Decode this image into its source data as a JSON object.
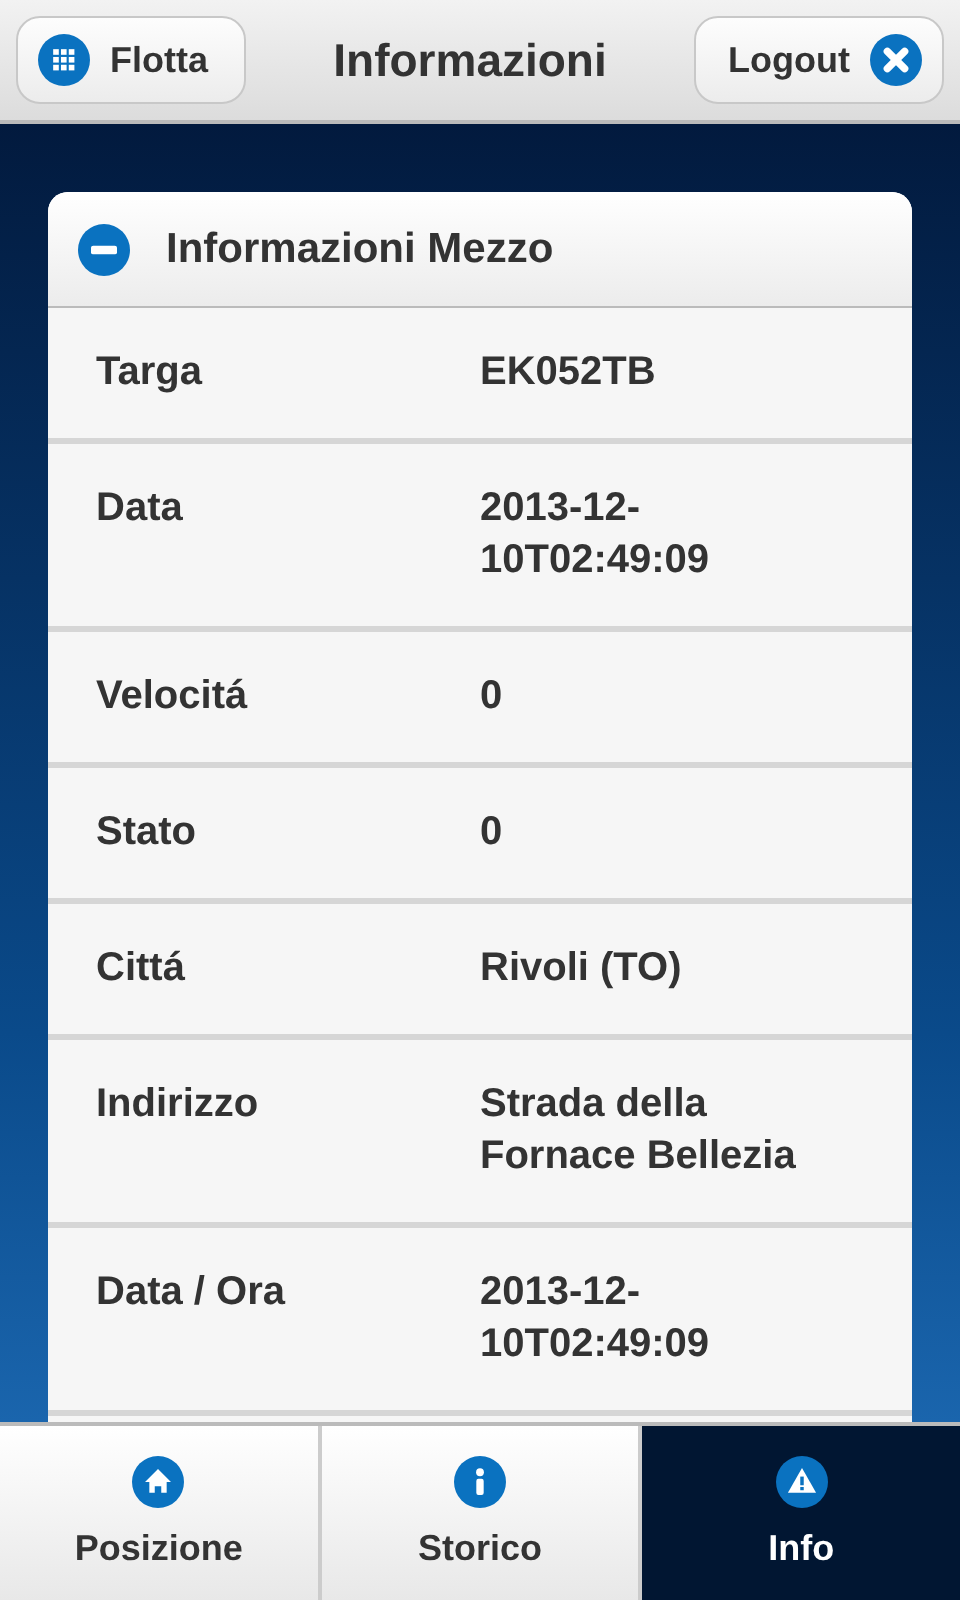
{
  "header": {
    "left_button": "Flotta",
    "title": "Informazioni",
    "right_button": "Logout"
  },
  "panel": {
    "title": "Informazioni Mezzo",
    "expanded": true,
    "rows": [
      {
        "label": "Targa",
        "value": "EK052TB"
      },
      {
        "label": "Data",
        "value": "2013-12-10T02:49:09"
      },
      {
        "label": "Velocitá",
        "value": "0"
      },
      {
        "label": "Stato",
        "value": "0"
      },
      {
        "label": "Cittá",
        "value": "Rivoli (TO)"
      },
      {
        "label": "Indirizzo",
        "value": "Strada della Fornace Bellezia"
      },
      {
        "label": "Data / Ora",
        "value": "2013-12-10T02:49:09"
      }
    ]
  },
  "tabs": [
    {
      "label": "Posizione",
      "selected": false
    },
    {
      "label": "Storico",
      "selected": false
    },
    {
      "label": "Info",
      "selected": true
    }
  ]
}
